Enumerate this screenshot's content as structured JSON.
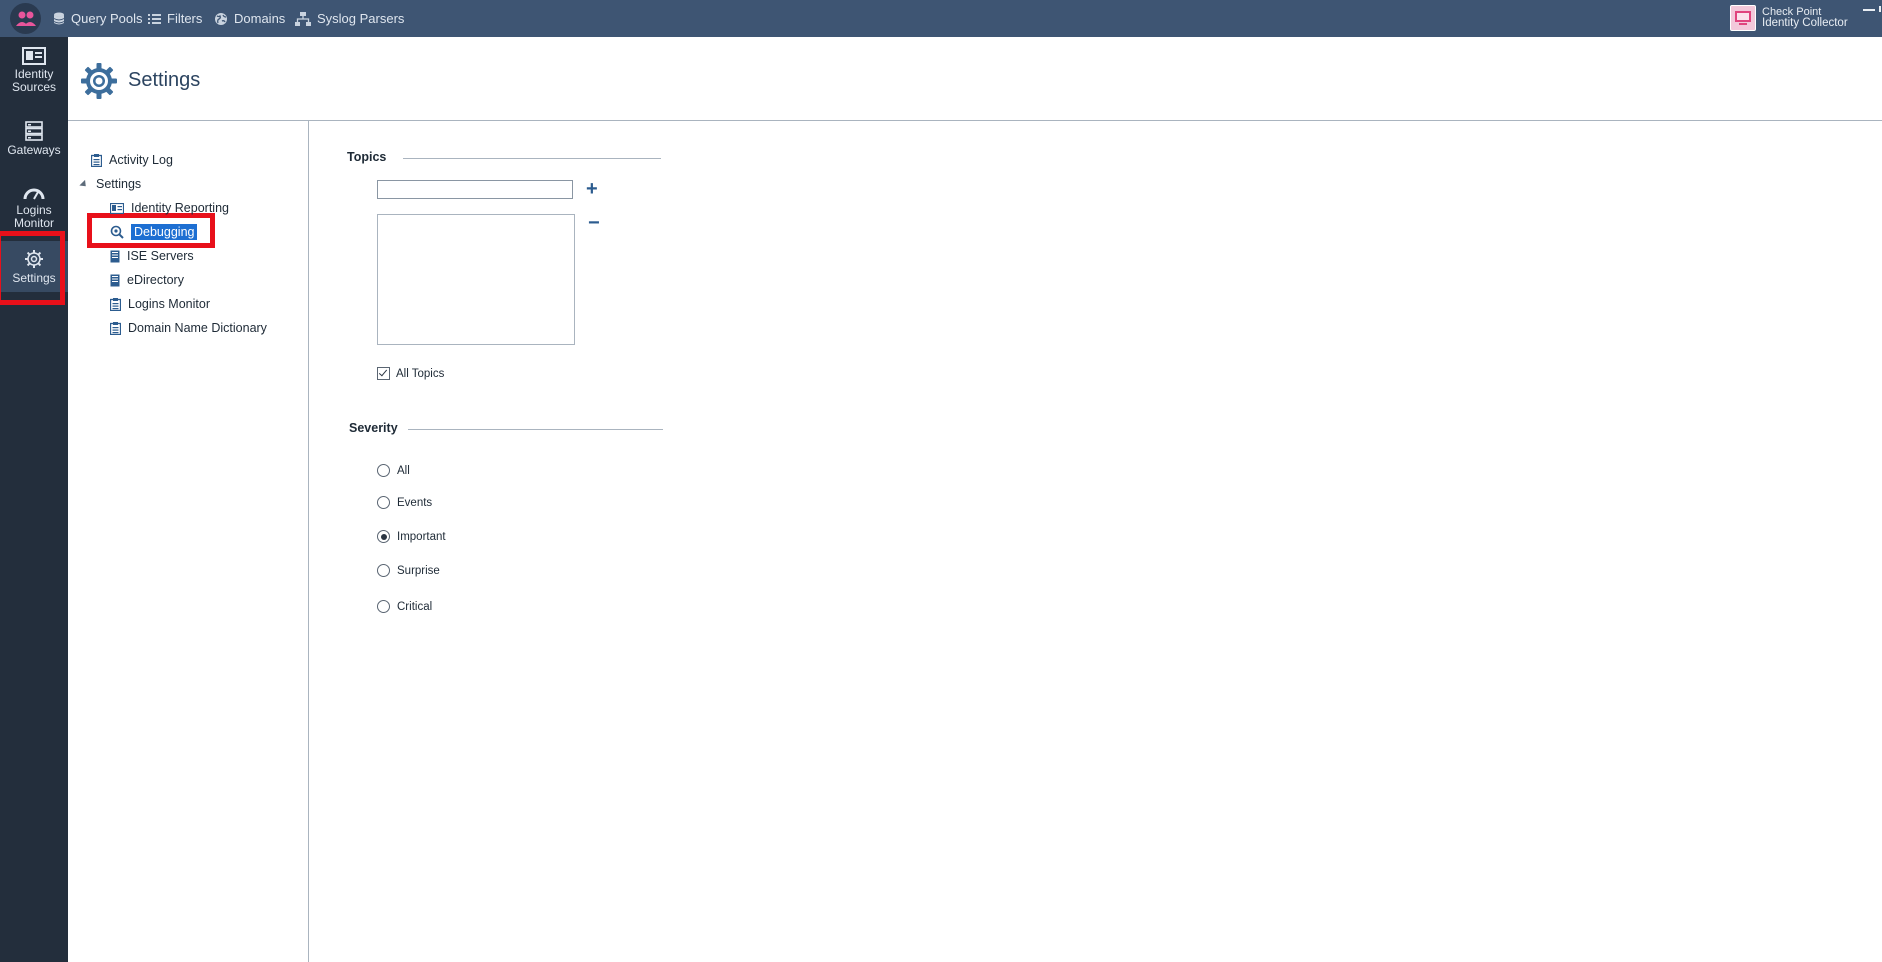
{
  "topbar": {
    "items": [
      {
        "label": "Query Pools",
        "icon": "database-icon"
      },
      {
        "label": "Filters",
        "icon": "list-icon"
      },
      {
        "label": "Domains",
        "icon": "globe-icon"
      },
      {
        "label": "Syslog Parsers",
        "icon": "network-icon"
      }
    ],
    "brand_line1": "Check Point",
    "brand_line2": "Identity Collector"
  },
  "leftnav": {
    "items": [
      {
        "label_line1": "Identity",
        "label_line2": "Sources"
      },
      {
        "label_line1": "Gateways",
        "label_line2": ""
      },
      {
        "label_line1": "Logins",
        "label_line2": "Monitor"
      },
      {
        "label_line1": "Settings",
        "label_line2": ""
      }
    ],
    "active": "Settings"
  },
  "header": {
    "title": "Settings"
  },
  "tree": {
    "activity_log": "Activity Log",
    "settings": "Settings",
    "identity_reporting": "Identity Reporting",
    "debugging": "Debugging",
    "ise_servers": "ISE Servers",
    "edirectory": "eDirectory",
    "logins_monitor": "Logins Monitor",
    "domain_name_dictionary": "Domain Name Dictionary",
    "selected": "Debugging"
  },
  "topics": {
    "title": "Topics",
    "input_value": "",
    "add_symbol": "+",
    "remove_symbol": "−",
    "all_topics_label": "All Topics",
    "all_topics_checked": true
  },
  "severity": {
    "title": "Severity",
    "options": [
      "All",
      "Events",
      "Important",
      "Surprise",
      "Critical"
    ],
    "selected": "Important"
  },
  "colors": {
    "topbar": "#3e5573",
    "leftnav": "#232e3c",
    "selection": "#1d6fd2",
    "highlight_box": "#e8101a"
  }
}
